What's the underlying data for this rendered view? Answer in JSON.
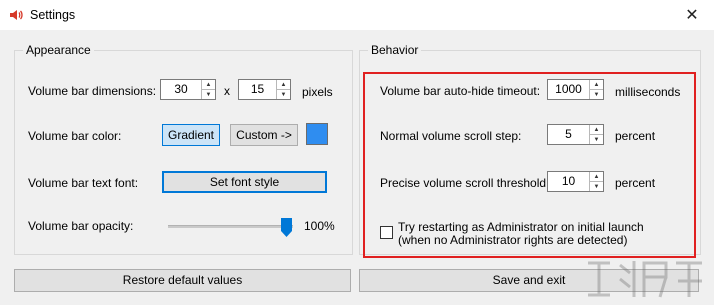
{
  "window": {
    "title": "Settings",
    "close_glyph": "✕"
  },
  "appearance": {
    "title": "Appearance",
    "dimensions": {
      "label": "Volume bar dimensions:",
      "width": "30",
      "x": "x",
      "height": "15",
      "unit": "pixels"
    },
    "color": {
      "label": "Volume bar color:",
      "gradient": "Gradient",
      "custom": "Custom ->",
      "swatch_color": "#2f8df0"
    },
    "font": {
      "label": "Volume bar text font:",
      "button": "Set font style"
    },
    "opacity": {
      "label": "Volume bar opacity:",
      "value_text": "100%",
      "level": 1.0
    }
  },
  "behavior": {
    "title": "Behavior",
    "timeout": {
      "label": "Volume bar auto-hide timeout:",
      "value": "1000",
      "unit": "milliseconds"
    },
    "scroll_step": {
      "label": "Normal volume scroll step:",
      "value": "5",
      "unit": "percent"
    },
    "precise": {
      "label": "Precise volume scroll threshold:",
      "value": "10",
      "unit": "percent"
    },
    "admin": {
      "line1": "Try restarting as Administrator on initial launch",
      "line2": "(when no Administrator rights are detected)",
      "checked": false
    }
  },
  "footer": {
    "restore": "Restore default values",
    "save": "Save and exit"
  },
  "colors": {
    "highlight": "#e02020",
    "accent": "#0078d7"
  },
  "icons": {
    "app": "speaker-icon",
    "close": "close-icon",
    "up": "spin-up-icon",
    "down": "spin-down-icon"
  }
}
